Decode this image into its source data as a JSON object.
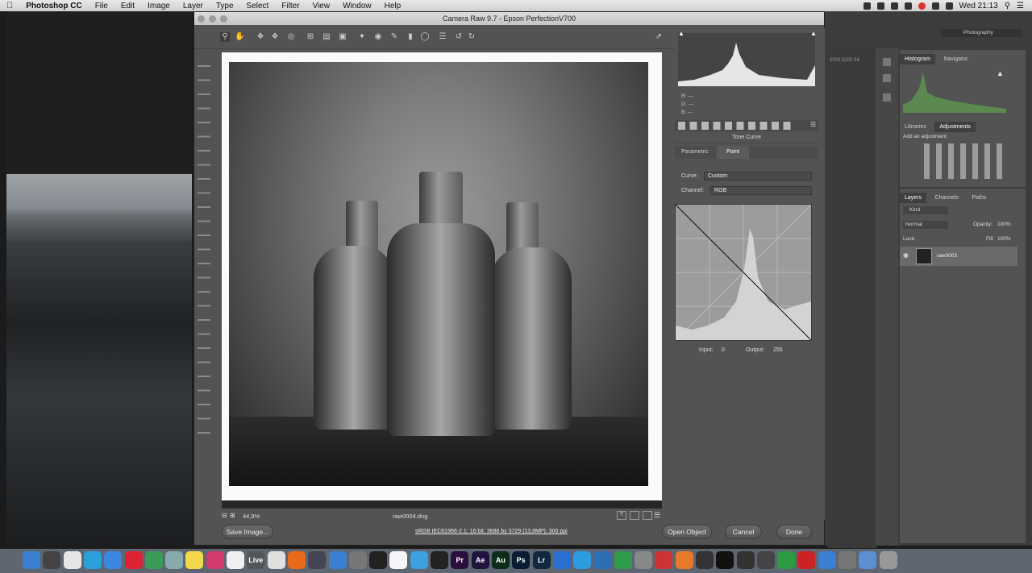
{
  "menubar": {
    "app": "Photoshop CC",
    "items": [
      "File",
      "Edit",
      "Image",
      "Layer",
      "Type",
      "Select",
      "Filter",
      "View",
      "Window",
      "Help"
    ],
    "clock": "Wed 21:13"
  },
  "cameraraw": {
    "title": "Camera Raw 9.7  -  Epson PerfectionV700",
    "zoom": "44,9%",
    "filename": "raw0004.dng",
    "workflow": "sRGB IEC61966-2.1; 16 bit; 3688 by 3729 (13,8MP); 300 ppi",
    "rgb": {
      "r": "R:  ---",
      "g": "G:  ---",
      "b": "B:  ---"
    },
    "panel_title": "Tone Curve",
    "tabs": [
      "Parametric",
      "Point"
    ],
    "curve_label": "Curve:",
    "curve_value": "Custom",
    "channel_label": "Channel:",
    "channel_value": "RGB",
    "input_label": "Input:",
    "input_value": "0",
    "output_label": "Output:",
    "output_value": "255",
    "buttons": {
      "save": "Save Image...",
      "open": "Open Object",
      "cancel": "Cancel",
      "done": "Done"
    }
  },
  "ps_right": {
    "workspace": "Photography",
    "hist_tabs": [
      "Histogram",
      "Navigator"
    ],
    "lib_tabs": [
      "Libraries",
      "Adjustments"
    ],
    "add_adjustment": "Add an adjustment",
    "layer_tabs": [
      "Layers",
      "Channels",
      "Paths"
    ],
    "kind": "Kind",
    "blend": "Normal",
    "opacity_label": "Opacity:",
    "opacity": "100%",
    "lock_label": "Lock:",
    "fill_label": "Fill:",
    "fill": "100%",
    "layer_name": "raw0003",
    "ruler": "5000  5200  54"
  },
  "dock": {
    "items": [
      "Finder",
      "Launchpad",
      "Chrome",
      "Telegram",
      "Safari",
      "Yandex",
      "Image",
      "Mail",
      "Notes",
      "iTunes",
      "Pages",
      "Live",
      "Preview",
      "Burn",
      "Photo",
      "Finder2",
      "Prefs",
      "Terminal",
      "Calendar",
      "Apps",
      "DaVinci",
      "Pr",
      "Ae",
      "Au",
      "Ps",
      "Lr",
      "Help",
      "Skype",
      "Pin",
      "Maps",
      "Utility",
      "Slice",
      "Firefox",
      "Clock",
      "Unity",
      "Tool1",
      "Tool2",
      "Numbers",
      "Acrobat",
      "Mx",
      "Script",
      "Folder",
      "Trash"
    ],
    "labels": {
      "Pr": "Pr",
      "Ae": "Ae",
      "Au": "Au",
      "Ps": "Ps",
      "Lr": "Lr",
      "Live": "Live"
    }
  }
}
